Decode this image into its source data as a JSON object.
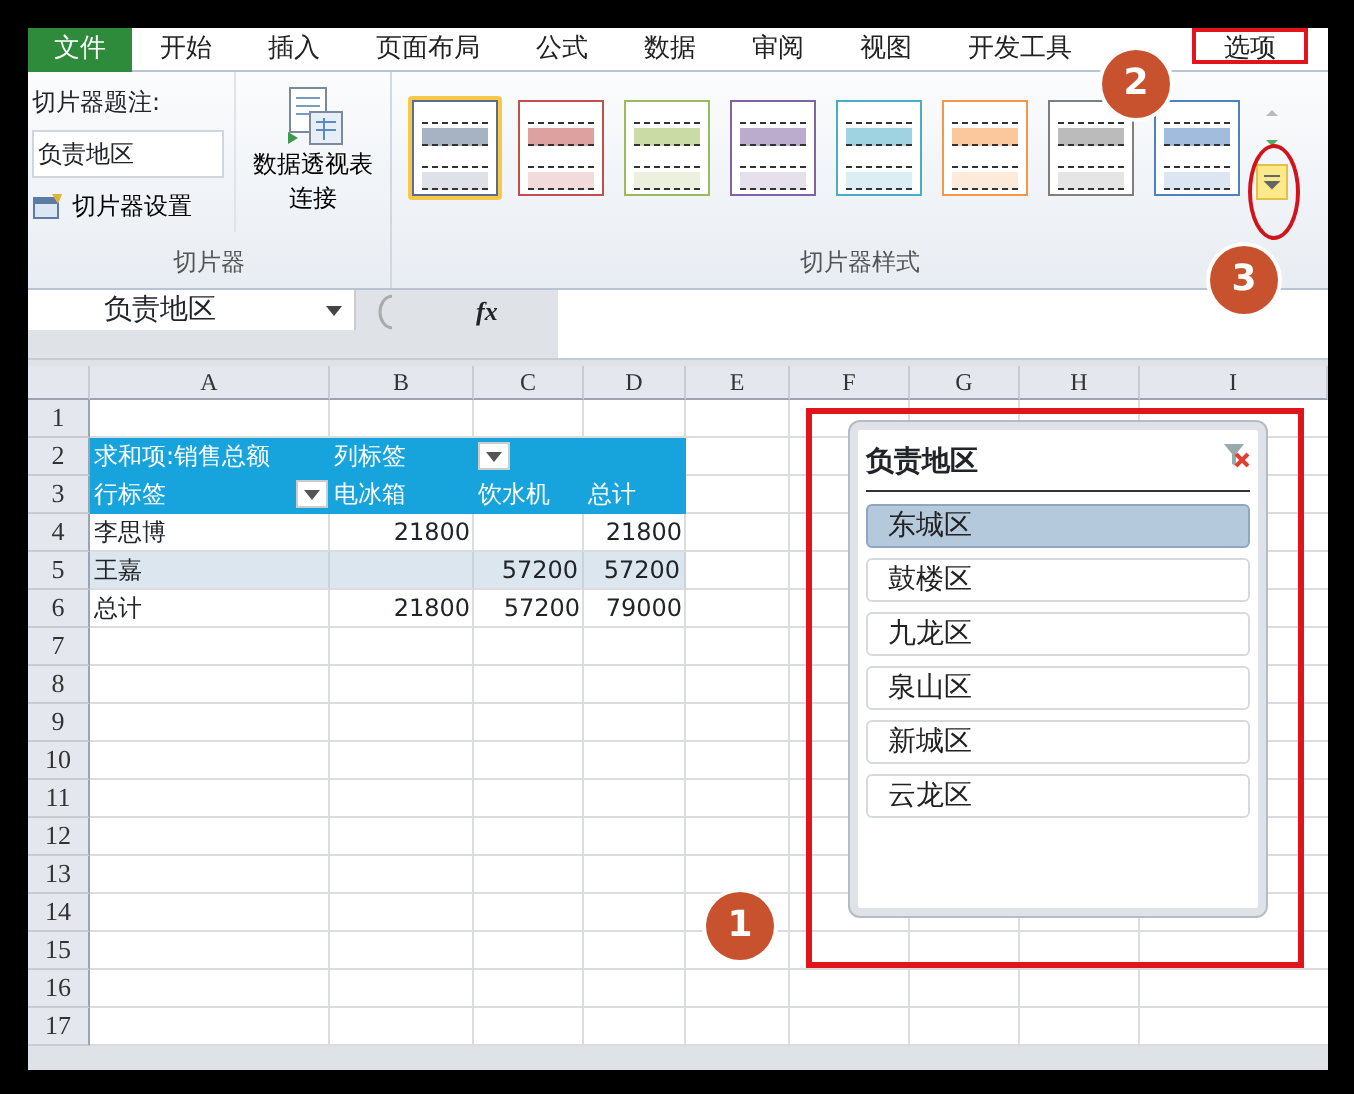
{
  "ribbon_tabs": [
    {
      "label": "文件",
      "kind": "file",
      "selected": false
    },
    {
      "label": "开始",
      "kind": "tab",
      "selected": false
    },
    {
      "label": "插入",
      "kind": "tab",
      "selected": false
    },
    {
      "label": "页面布局",
      "kind": "tab",
      "selected": false
    },
    {
      "label": "公式",
      "kind": "tab",
      "selected": false
    },
    {
      "label": "数据",
      "kind": "tab",
      "selected": false
    },
    {
      "label": "审阅",
      "kind": "tab",
      "selected": false
    },
    {
      "label": "视图",
      "kind": "tab",
      "selected": false
    },
    {
      "label": "开发工具",
      "kind": "tab",
      "selected": false
    },
    {
      "label": "选项",
      "kind": "tab",
      "selected": true
    }
  ],
  "slicer_group": {
    "caption_label": "切片器题注:",
    "caption_value": "负责地区",
    "settings_button": "切片器设置",
    "connections_button_lines": [
      "数据透视表",
      "连接"
    ],
    "group_label": "切片器"
  },
  "styles_group": {
    "styles": [
      {
        "color": "#5a6e8c",
        "selected": true
      },
      {
        "color": "#c0504d",
        "selected": false
      },
      {
        "color": "#9bbb59",
        "selected": false
      },
      {
        "color": "#8064a2",
        "selected": false
      },
      {
        "color": "#4bacc6",
        "selected": false
      },
      {
        "color": "#f79646",
        "selected": false
      },
      {
        "color": "#7f7f7f",
        "selected": false
      },
      {
        "color": "#4f81bd",
        "selected": false
      }
    ],
    "group_label": "切片器样式"
  },
  "formula_bar": {
    "name_box": "负责地区",
    "function_label": "fx"
  },
  "sheet": {
    "columns": [
      "A",
      "B",
      "C",
      "D",
      "E",
      "F",
      "G",
      "H",
      "I"
    ],
    "rows": [
      {
        "number": "1",
        "kind": "empty",
        "cells": []
      },
      {
        "number": "2",
        "kind": "header",
        "cells": [
          {
            "text": "求和项:销售总额"
          },
          {
            "text": "列标签"
          },
          {
            "text": "",
            "filter_button": true
          },
          {
            "text": ""
          }
        ]
      },
      {
        "number": "3",
        "kind": "header",
        "cells": [
          {
            "text": "行标签",
            "filter_button": true
          },
          {
            "text": "电冰箱"
          },
          {
            "text": "饮水机"
          },
          {
            "text": "总计"
          }
        ]
      },
      {
        "number": "4",
        "kind": "data",
        "cells": [
          {
            "text": "李思博"
          },
          {
            "text": "21800"
          },
          {
            "text": ""
          },
          {
            "text": "21800"
          }
        ]
      },
      {
        "number": "5",
        "kind": "banded",
        "cells": [
          {
            "text": "王嘉"
          },
          {
            "text": ""
          },
          {
            "text": "57200"
          },
          {
            "text": "57200"
          }
        ]
      },
      {
        "number": "6",
        "kind": "data",
        "cells": [
          {
            "text": "总计"
          },
          {
            "text": "21800"
          },
          {
            "text": "57200"
          },
          {
            "text": "79000"
          }
        ]
      },
      {
        "number": "7",
        "kind": "empty",
        "cells": []
      },
      {
        "number": "8",
        "kind": "empty",
        "cells": []
      },
      {
        "number": "9",
        "kind": "empty",
        "cells": []
      },
      {
        "number": "10",
        "kind": "empty",
        "cells": []
      },
      {
        "number": "11",
        "kind": "empty",
        "cells": []
      },
      {
        "number": "12",
        "kind": "empty",
        "cells": []
      },
      {
        "number": "13",
        "kind": "empty",
        "cells": []
      },
      {
        "number": "14",
        "kind": "empty",
        "cells": []
      },
      {
        "number": "15",
        "kind": "empty",
        "cells": []
      },
      {
        "number": "16",
        "kind": "empty",
        "cells": []
      },
      {
        "number": "17",
        "kind": "empty",
        "cells": []
      }
    ]
  },
  "slicer": {
    "title": "负责地区",
    "items": [
      {
        "label": "东城区",
        "selected": true
      },
      {
        "label": "鼓楼区",
        "selected": false
      },
      {
        "label": "九龙区",
        "selected": false
      },
      {
        "label": "泉山区",
        "selected": false
      },
      {
        "label": "新城区",
        "selected": false
      },
      {
        "label": "云龙区",
        "selected": false
      }
    ]
  },
  "step_markers": [
    {
      "label": "1"
    },
    {
      "label": "2"
    },
    {
      "label": "3"
    }
  ]
}
